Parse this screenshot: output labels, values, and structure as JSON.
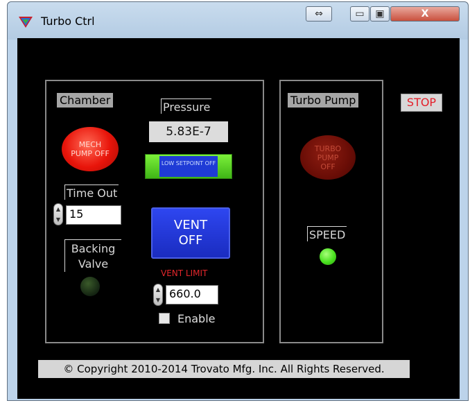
{
  "window": {
    "title": "Turbo Ctrl",
    "controls": {
      "resize": "⇔",
      "minimize": "▭",
      "maximize": "▣",
      "close": "X"
    }
  },
  "chamber": {
    "label": "Chamber",
    "mech_pump_led": "MECH PUMP OFF",
    "time_out": {
      "label": "Time Out",
      "value": "15"
    },
    "backing_valve": {
      "label": "Backing Valve"
    }
  },
  "pressure": {
    "label": "Pressure",
    "value": "5.83E-7",
    "setpoint_indicator": "LOW SETPOINT OFF"
  },
  "vent": {
    "button_label": "VENT OFF",
    "limit_label": "VENT LIMIT",
    "limit_value": "660.0",
    "enable_label": "Enable",
    "enabled": false
  },
  "turbo_pump": {
    "label": "Turbo Pump",
    "led": "TURBO PUMP OFF",
    "speed_label": "SPEED"
  },
  "stop_label": "STOP",
  "copyright": "© Copyright 2010-2014 Trovato Mfg. Inc. All Rights Reserved.",
  "colors": {
    "led_red": "#ff2a1a",
    "led_dark_red": "#6e0f08",
    "led_green": "#49e01f",
    "vent_blue": "#1e33dd",
    "setpoint_green": "#5fd620",
    "stop_red": "#e4202a"
  }
}
